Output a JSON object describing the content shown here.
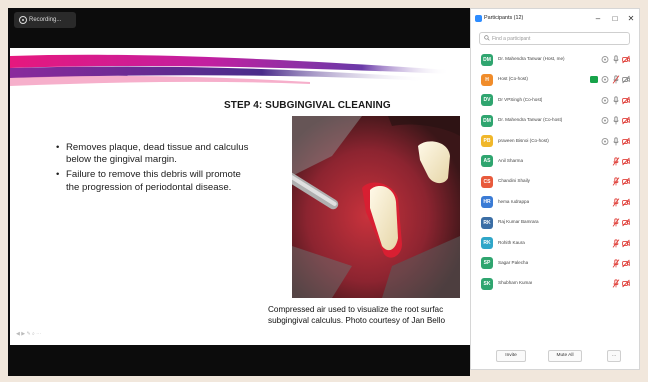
{
  "meeting": {
    "recording_label": "Recording..."
  },
  "slide": {
    "title": "STEP 4: SUBGINGIVAL CLEANING",
    "bullets": [
      "Removes plaque, dead tissue and calculus below the gingival margin.",
      "Failure to remove this debris will promote the progression of periodontal disease."
    ],
    "caption_line1": "Compressed air used to visualize the root surfac",
    "caption_line2": "subgingival calculus. Photo courtesy of Jan Bello"
  },
  "panel": {
    "title": "Participants (12)",
    "window_buttons": {
      "minimize": "–",
      "maximize": "□",
      "close": "✕"
    },
    "search_placeholder": "Find a participant",
    "participants": [
      {
        "initials": "DM",
        "name": "Dr. Mahendra Tanwar (Host, me)",
        "color": "#2fa56f",
        "chat": false
      },
      {
        "initials": "H",
        "name": "Host (Co-host)",
        "color": "#f08c2a",
        "chat": true
      },
      {
        "initials": "DV",
        "name": "Dr VPSingh (Co-host)",
        "color": "#2fa56f",
        "chat": false
      },
      {
        "initials": "DM",
        "name": "Dr. Mahendra Tanwar (Co-host)",
        "color": "#2fa56f",
        "chat": false
      },
      {
        "initials": "PB",
        "name": "praveen Bisnoi (Co-host)",
        "color": "#f0b72a",
        "chat": false
      },
      {
        "initials": "AS",
        "name": "Anil Sharma",
        "color": "#2fa56f",
        "chat": false
      },
      {
        "initials": "CS",
        "name": "Chandini Shaily",
        "color": "#e85a3c",
        "chat": false
      },
      {
        "initials": "HR",
        "name": "hema rudrappa",
        "color": "#3a7bd5",
        "chat": false
      },
      {
        "initials": "RK",
        "name": "Raj Kumar Bamrara",
        "color": "#3b6ea5",
        "chat": false
      },
      {
        "initials": "RK",
        "name": "Rohith Kaura",
        "color": "#2fa6c8",
        "chat": false
      },
      {
        "initials": "SP",
        "name": "Sagar Palecha",
        "color": "#2fa56f",
        "chat": false
      },
      {
        "initials": "SK",
        "name": "Shubham Kumar",
        "color": "#2fa56f",
        "chat": false
      }
    ],
    "invite_label": "Invite",
    "mute_all_label": "Mute All",
    "more_label": "..."
  },
  "colors": {
    "accent": "#2d8cff",
    "muted_red": "#e0413b",
    "slide_magenta": "#e4147a",
    "slide_purple": "#7b2d8e"
  }
}
